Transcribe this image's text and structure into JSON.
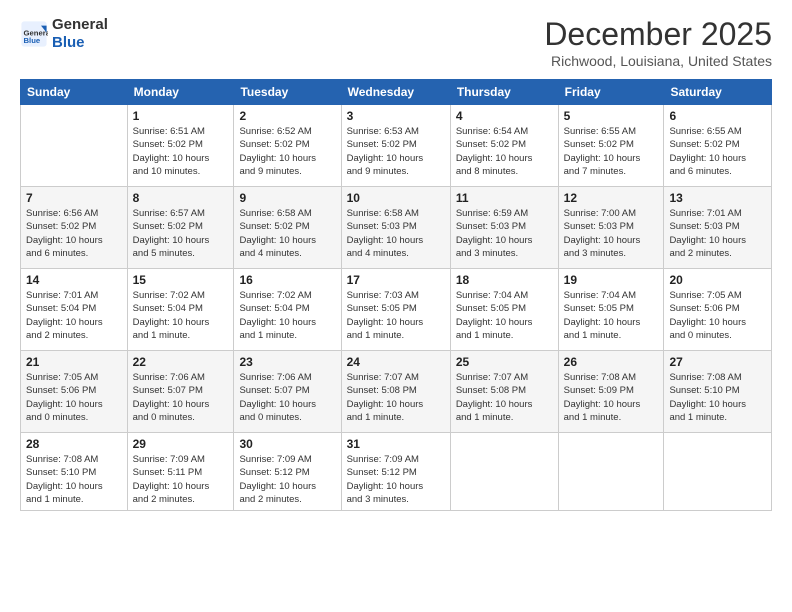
{
  "logo": {
    "general": "General",
    "blue": "Blue"
  },
  "title": "December 2025",
  "location": "Richwood, Louisiana, United States",
  "days_of_week": [
    "Sunday",
    "Monday",
    "Tuesday",
    "Wednesday",
    "Thursday",
    "Friday",
    "Saturday"
  ],
  "weeks": [
    [
      {
        "day": "",
        "info": ""
      },
      {
        "day": "1",
        "info": "Sunrise: 6:51 AM\nSunset: 5:02 PM\nDaylight: 10 hours\nand 10 minutes."
      },
      {
        "day": "2",
        "info": "Sunrise: 6:52 AM\nSunset: 5:02 PM\nDaylight: 10 hours\nand 9 minutes."
      },
      {
        "day": "3",
        "info": "Sunrise: 6:53 AM\nSunset: 5:02 PM\nDaylight: 10 hours\nand 9 minutes."
      },
      {
        "day": "4",
        "info": "Sunrise: 6:54 AM\nSunset: 5:02 PM\nDaylight: 10 hours\nand 8 minutes."
      },
      {
        "day": "5",
        "info": "Sunrise: 6:55 AM\nSunset: 5:02 PM\nDaylight: 10 hours\nand 7 minutes."
      },
      {
        "day": "6",
        "info": "Sunrise: 6:55 AM\nSunset: 5:02 PM\nDaylight: 10 hours\nand 6 minutes."
      }
    ],
    [
      {
        "day": "7",
        "info": "Sunrise: 6:56 AM\nSunset: 5:02 PM\nDaylight: 10 hours\nand 6 minutes."
      },
      {
        "day": "8",
        "info": "Sunrise: 6:57 AM\nSunset: 5:02 PM\nDaylight: 10 hours\nand 5 minutes."
      },
      {
        "day": "9",
        "info": "Sunrise: 6:58 AM\nSunset: 5:02 PM\nDaylight: 10 hours\nand 4 minutes."
      },
      {
        "day": "10",
        "info": "Sunrise: 6:58 AM\nSunset: 5:03 PM\nDaylight: 10 hours\nand 4 minutes."
      },
      {
        "day": "11",
        "info": "Sunrise: 6:59 AM\nSunset: 5:03 PM\nDaylight: 10 hours\nand 3 minutes."
      },
      {
        "day": "12",
        "info": "Sunrise: 7:00 AM\nSunset: 5:03 PM\nDaylight: 10 hours\nand 3 minutes."
      },
      {
        "day": "13",
        "info": "Sunrise: 7:01 AM\nSunset: 5:03 PM\nDaylight: 10 hours\nand 2 minutes."
      }
    ],
    [
      {
        "day": "14",
        "info": "Sunrise: 7:01 AM\nSunset: 5:04 PM\nDaylight: 10 hours\nand 2 minutes."
      },
      {
        "day": "15",
        "info": "Sunrise: 7:02 AM\nSunset: 5:04 PM\nDaylight: 10 hours\nand 1 minute."
      },
      {
        "day": "16",
        "info": "Sunrise: 7:02 AM\nSunset: 5:04 PM\nDaylight: 10 hours\nand 1 minute."
      },
      {
        "day": "17",
        "info": "Sunrise: 7:03 AM\nSunset: 5:05 PM\nDaylight: 10 hours\nand 1 minute."
      },
      {
        "day": "18",
        "info": "Sunrise: 7:04 AM\nSunset: 5:05 PM\nDaylight: 10 hours\nand 1 minute."
      },
      {
        "day": "19",
        "info": "Sunrise: 7:04 AM\nSunset: 5:05 PM\nDaylight: 10 hours\nand 1 minute."
      },
      {
        "day": "20",
        "info": "Sunrise: 7:05 AM\nSunset: 5:06 PM\nDaylight: 10 hours\nand 0 minutes."
      }
    ],
    [
      {
        "day": "21",
        "info": "Sunrise: 7:05 AM\nSunset: 5:06 PM\nDaylight: 10 hours\nand 0 minutes."
      },
      {
        "day": "22",
        "info": "Sunrise: 7:06 AM\nSunset: 5:07 PM\nDaylight: 10 hours\nand 0 minutes."
      },
      {
        "day": "23",
        "info": "Sunrise: 7:06 AM\nSunset: 5:07 PM\nDaylight: 10 hours\nand 0 minutes."
      },
      {
        "day": "24",
        "info": "Sunrise: 7:07 AM\nSunset: 5:08 PM\nDaylight: 10 hours\nand 1 minute."
      },
      {
        "day": "25",
        "info": "Sunrise: 7:07 AM\nSunset: 5:08 PM\nDaylight: 10 hours\nand 1 minute."
      },
      {
        "day": "26",
        "info": "Sunrise: 7:08 AM\nSunset: 5:09 PM\nDaylight: 10 hours\nand 1 minute."
      },
      {
        "day": "27",
        "info": "Sunrise: 7:08 AM\nSunset: 5:10 PM\nDaylight: 10 hours\nand 1 minute."
      }
    ],
    [
      {
        "day": "28",
        "info": "Sunrise: 7:08 AM\nSunset: 5:10 PM\nDaylight: 10 hours\nand 1 minute."
      },
      {
        "day": "29",
        "info": "Sunrise: 7:09 AM\nSunset: 5:11 PM\nDaylight: 10 hours\nand 2 minutes."
      },
      {
        "day": "30",
        "info": "Sunrise: 7:09 AM\nSunset: 5:12 PM\nDaylight: 10 hours\nand 2 minutes."
      },
      {
        "day": "31",
        "info": "Sunrise: 7:09 AM\nSunset: 5:12 PM\nDaylight: 10 hours\nand 3 minutes."
      },
      {
        "day": "",
        "info": ""
      },
      {
        "day": "",
        "info": ""
      },
      {
        "day": "",
        "info": ""
      }
    ]
  ]
}
